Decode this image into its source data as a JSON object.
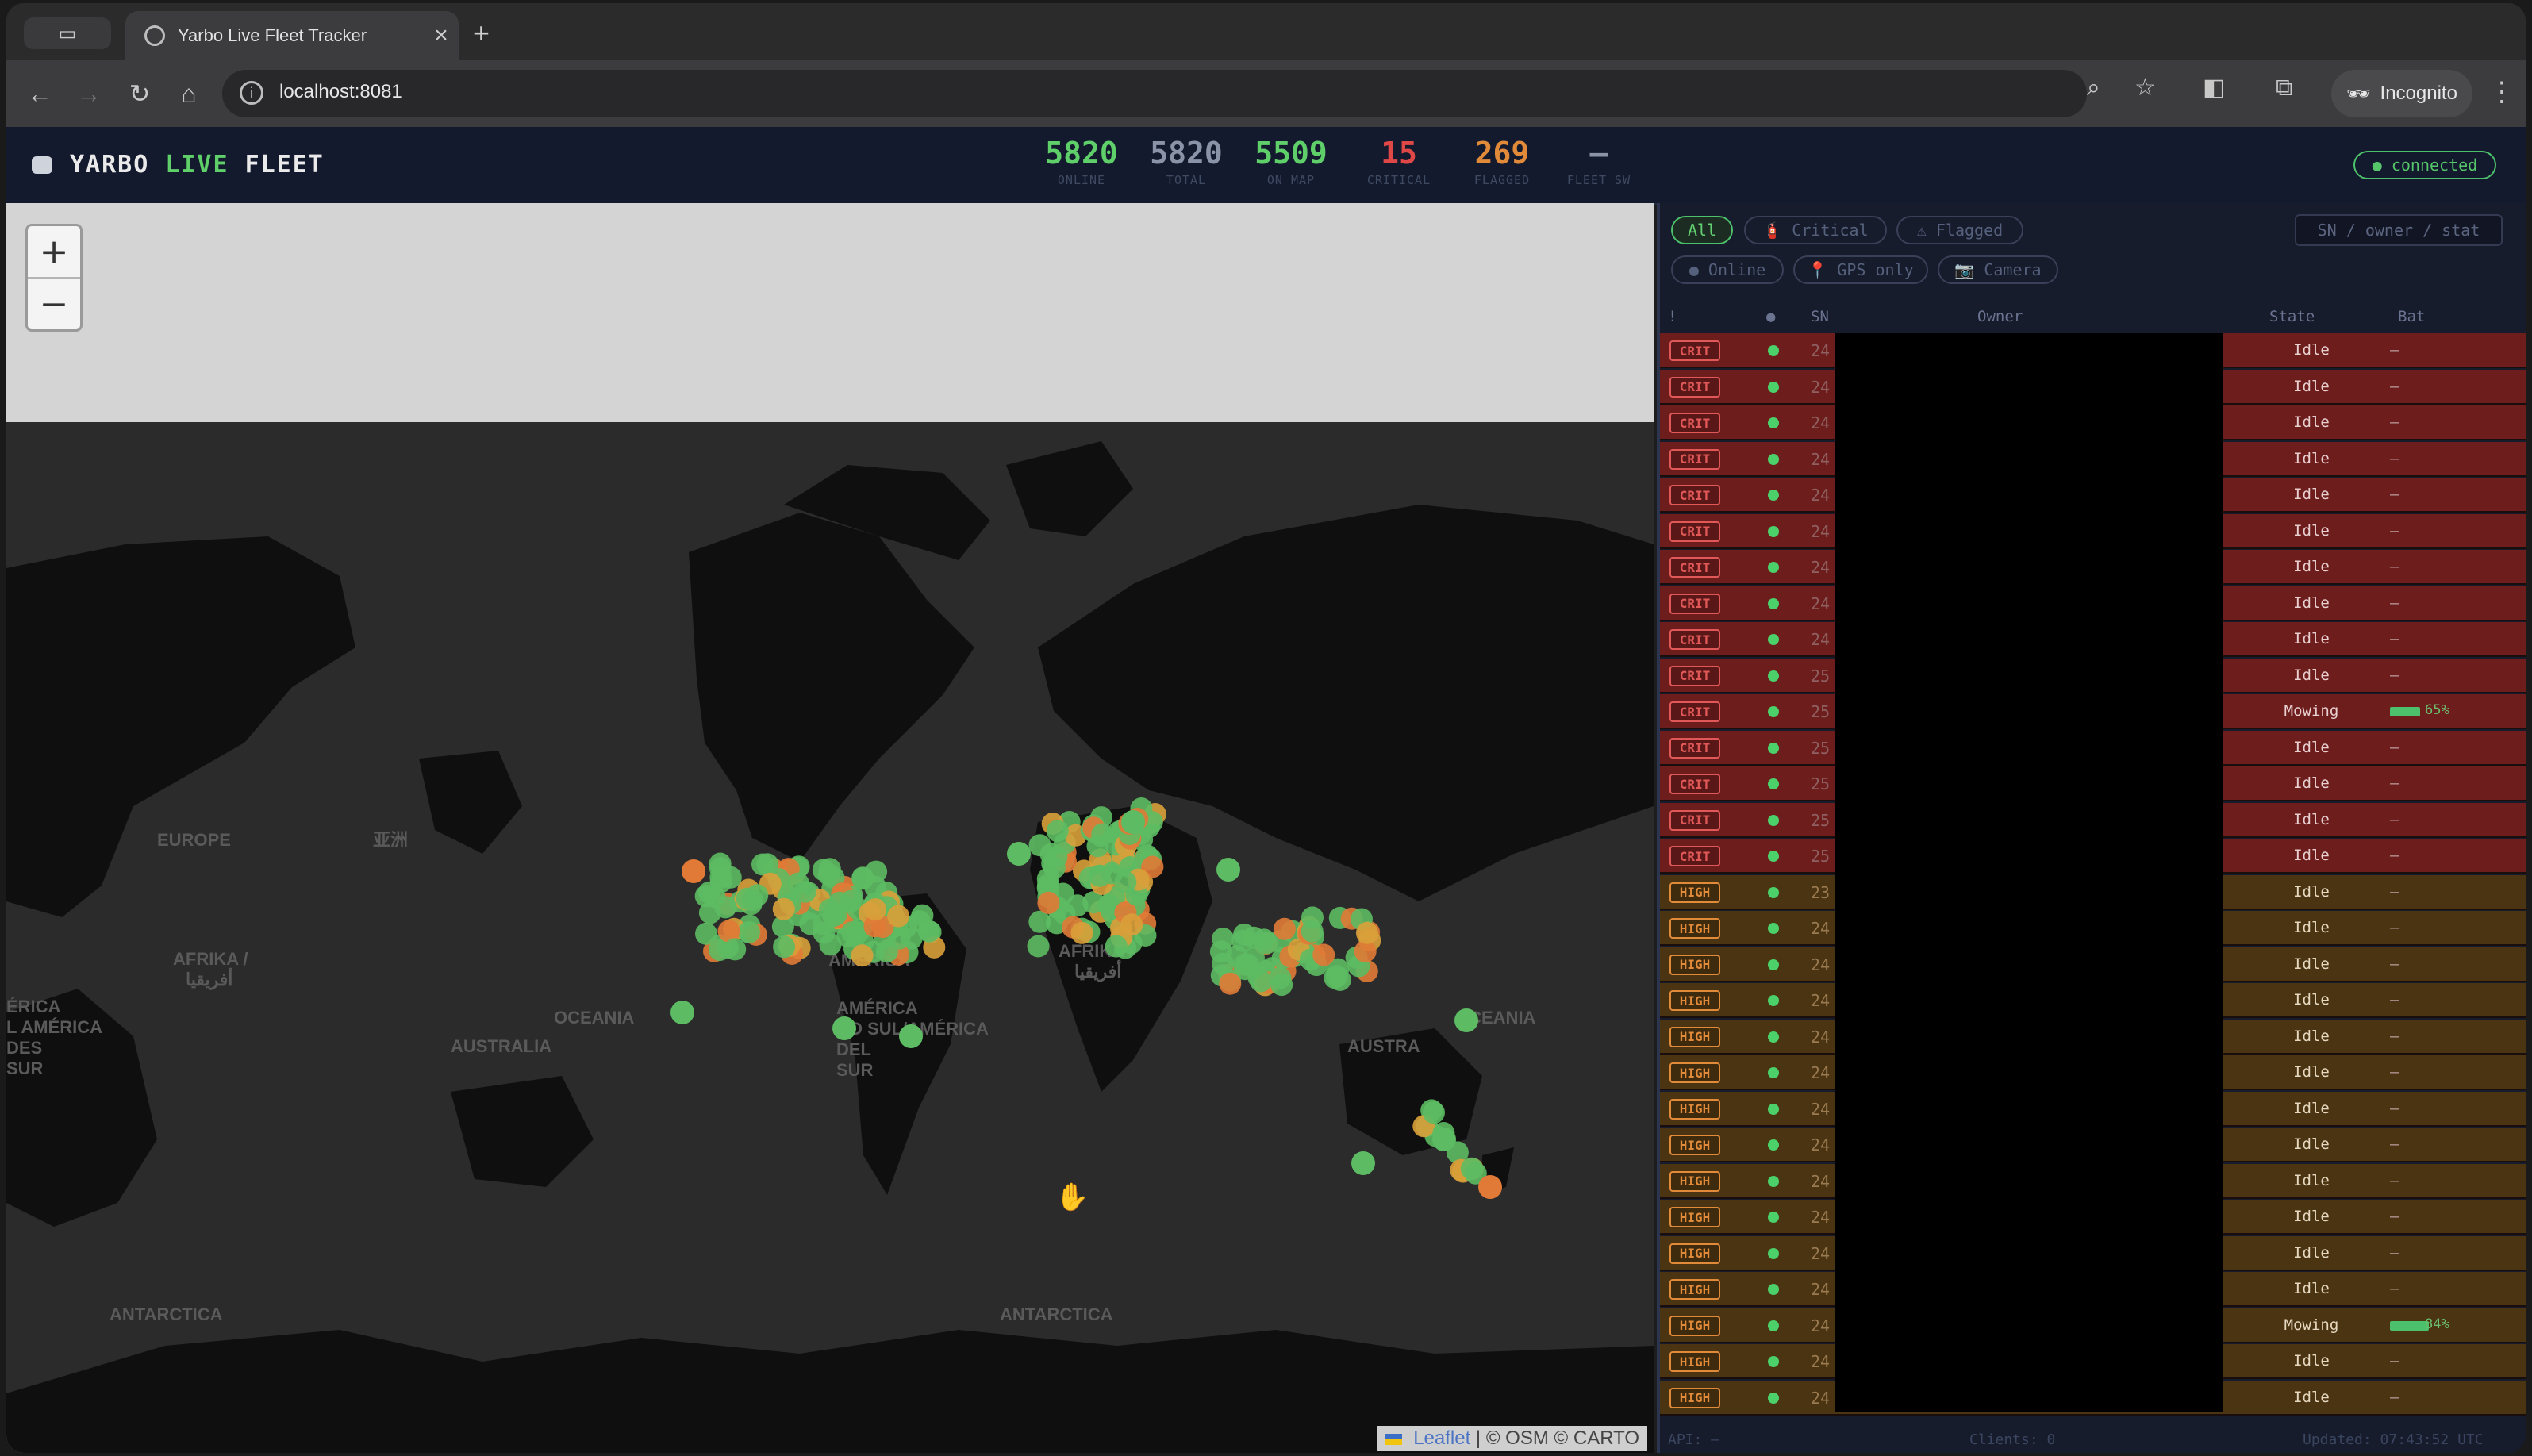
{
  "browser": {
    "tab_title": "Yarbo Live Fleet Tracker",
    "tab_close": "×",
    "new_tab": "+",
    "url": "localhost:8081",
    "incognito_label": "Incognito"
  },
  "header": {
    "brand": {
      "yarbo": "YARBO",
      "live": "LIVE",
      "fleet": "FLEET"
    },
    "stats": [
      {
        "value": "5820",
        "label": "ONLINE",
        "color": "#5fcf6a"
      },
      {
        "value": "5820",
        "label": "TOTAL",
        "color": "#8a93a8"
      },
      {
        "value": "5509",
        "label": "ON MAP",
        "color": "#5fcf6a"
      },
      {
        "value": "15",
        "label": "CRITICAL",
        "color": "#e04848"
      },
      {
        "value": "269",
        "label": "FLAGGED",
        "color": "#e08a3a"
      },
      {
        "value": "—",
        "label": "FLEET SW",
        "color": "#8a93a8"
      }
    ],
    "connection": "● connected"
  },
  "map": {
    "zoom_in": "+",
    "zoom_out": "−",
    "labels": {
      "europe": "EUROPE",
      "europe_cjk": "亚洲",
      "afrika1": "AFRIKA /",
      "afrika1_ar": "أفريقيا",
      "america_n": "AMÉRICA",
      "oceania1": "OCEANIA",
      "australia1": "AUSTRALIA",
      "sa_left": "ÉRICA\nL AMÉRICA\nDES\nSUR",
      "america_s": "AMÉRICA\nDO SUL/AMÉRICA\nDEL\nSUR",
      "afrika2": "AFRIKA /",
      "afrika2_ar": "أفريقيا",
      "australia2": "AUSTRA",
      "oceania2": "OCEANIA",
      "antarctica1": "ANTARCTICA",
      "antarctica2": "ANTARCTICA"
    },
    "attribution": {
      "leaflet": "Leaflet",
      "rest": " | © OSM © CARTO"
    }
  },
  "panel": {
    "filters": [
      {
        "label": "All",
        "active": true
      },
      {
        "label": "🧯 Critical",
        "active": false
      },
      {
        "label": "⚠ Flagged",
        "active": false
      },
      {
        "label": "● Online",
        "active": false
      },
      {
        "label": "📍 GPS only",
        "active": false
      },
      {
        "label": "📷 Camera",
        "active": false
      }
    ],
    "search_placeholder": "SN / owner / stat",
    "columns": {
      "sort": "!",
      "status": "●",
      "sn": "SN",
      "owner": "Owner",
      "state": "State",
      "bat": "Bat"
    },
    "rows": [
      {
        "tag": "CRIT",
        "sn": "24",
        "state": "Idle",
        "bat": "—"
      },
      {
        "tag": "CRIT",
        "sn": "24",
        "state": "Idle",
        "bat": "—"
      },
      {
        "tag": "CRIT",
        "sn": "24",
        "state": "Idle",
        "bat": "—"
      },
      {
        "tag": "CRIT",
        "sn": "24",
        "state": "Idle",
        "bat": "—"
      },
      {
        "tag": "CRIT",
        "sn": "24",
        "state": "Idle",
        "bat": "—"
      },
      {
        "tag": "CRIT",
        "sn": "24",
        "state": "Idle",
        "bat": "—"
      },
      {
        "tag": "CRIT",
        "sn": "24",
        "state": "Idle",
        "bat": "—"
      },
      {
        "tag": "CRIT",
        "sn": "24",
        "state": "Idle",
        "bat": "—"
      },
      {
        "tag": "CRIT",
        "sn": "24",
        "state": "Idle",
        "bat": "—"
      },
      {
        "tag": "CRIT",
        "sn": "25",
        "state": "Idle",
        "bat": "—"
      },
      {
        "tag": "CRIT",
        "sn": "25",
        "state": "Mowing",
        "bat": "65%",
        "bat_level": 0.65
      },
      {
        "tag": "CRIT",
        "sn": "25",
        "state": "Idle",
        "bat": "—"
      },
      {
        "tag": "CRIT",
        "sn": "25",
        "state": "Idle",
        "bat": "—"
      },
      {
        "tag": "CRIT",
        "sn": "25",
        "state": "Idle",
        "bat": "—"
      },
      {
        "tag": "CRIT",
        "sn": "25",
        "state": "Idle",
        "bat": "—"
      },
      {
        "tag": "HIGH",
        "sn": "23",
        "state": "Idle",
        "bat": "—"
      },
      {
        "tag": "HIGH",
        "sn": "24",
        "state": "Idle",
        "bat": "—"
      },
      {
        "tag": "HIGH",
        "sn": "24",
        "state": "Idle",
        "bat": "—"
      },
      {
        "tag": "HIGH",
        "sn": "24",
        "state": "Idle",
        "bat": "—"
      },
      {
        "tag": "HIGH",
        "sn": "24",
        "state": "Idle",
        "bat": "—"
      },
      {
        "tag": "HIGH",
        "sn": "24",
        "state": "Idle",
        "bat": "—"
      },
      {
        "tag": "HIGH",
        "sn": "24",
        "state": "Idle",
        "bat": "—"
      },
      {
        "tag": "HIGH",
        "sn": "24",
        "state": "Idle",
        "bat": "—"
      },
      {
        "tag": "HIGH",
        "sn": "24",
        "state": "Idle",
        "bat": "—"
      },
      {
        "tag": "HIGH",
        "sn": "24",
        "state": "Idle",
        "bat": "—"
      },
      {
        "tag": "HIGH",
        "sn": "24",
        "state": "Idle",
        "bat": "—"
      },
      {
        "tag": "HIGH",
        "sn": "24",
        "state": "Idle",
        "bat": "—"
      },
      {
        "tag": "HIGH",
        "sn": "24",
        "state": "Mowing",
        "bat": "84%",
        "bat_level": 0.84
      },
      {
        "tag": "HIGH",
        "sn": "24",
        "state": "Idle",
        "bat": "—"
      },
      {
        "tag": "HIGH",
        "sn": "24",
        "state": "Idle",
        "bat": "—"
      }
    ],
    "footer": {
      "api": "API: —",
      "clients": "Clients: 0",
      "updated": "Updated: 07:43:52 UTC"
    }
  },
  "colors": {
    "online_dot": "#4cd06a",
    "crit_row": "#6e1d1d",
    "high_row": "#4a3411",
    "accent": "#5fcf6a"
  }
}
